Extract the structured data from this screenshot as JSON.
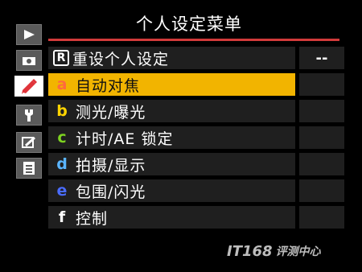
{
  "header": {
    "title": "个人设定菜单"
  },
  "tabs": [
    {
      "id": "playback",
      "icon": "play-icon"
    },
    {
      "id": "shooting",
      "icon": "camera-icon"
    },
    {
      "id": "custom",
      "icon": "pencil-icon",
      "active": true
    },
    {
      "id": "setup",
      "icon": "wrench-icon"
    },
    {
      "id": "retouch",
      "icon": "retouch-brush-icon"
    },
    {
      "id": "mymenu",
      "icon": "list-icon"
    }
  ],
  "menu": {
    "reset": {
      "badge": "R",
      "label": "重设个人设定",
      "value": "--"
    },
    "items": [
      {
        "letter": "a",
        "letter_color": "#ff6a3d",
        "label": "自动对焦",
        "selected": true
      },
      {
        "letter": "b",
        "letter_color": "#ffd400",
        "label": "测光/曝光"
      },
      {
        "letter": "c",
        "letter_color": "#7ed321",
        "label": "计时/AE 锁定"
      },
      {
        "letter": "d",
        "letter_color": "#5ab4ff",
        "label": "拍摄/显示"
      },
      {
        "letter": "e",
        "letter_color": "#4a6cff",
        "label": "包围/闪光"
      },
      {
        "letter": "f",
        "letter_color": "#ffffff",
        "label": "控制"
      }
    ]
  },
  "watermark": {
    "brand": "IT168",
    "text": "评测中心"
  },
  "colors": {
    "accent_line": "#d23a3a",
    "selection": "#f2b400",
    "row_bg": "#1f1f1f"
  }
}
